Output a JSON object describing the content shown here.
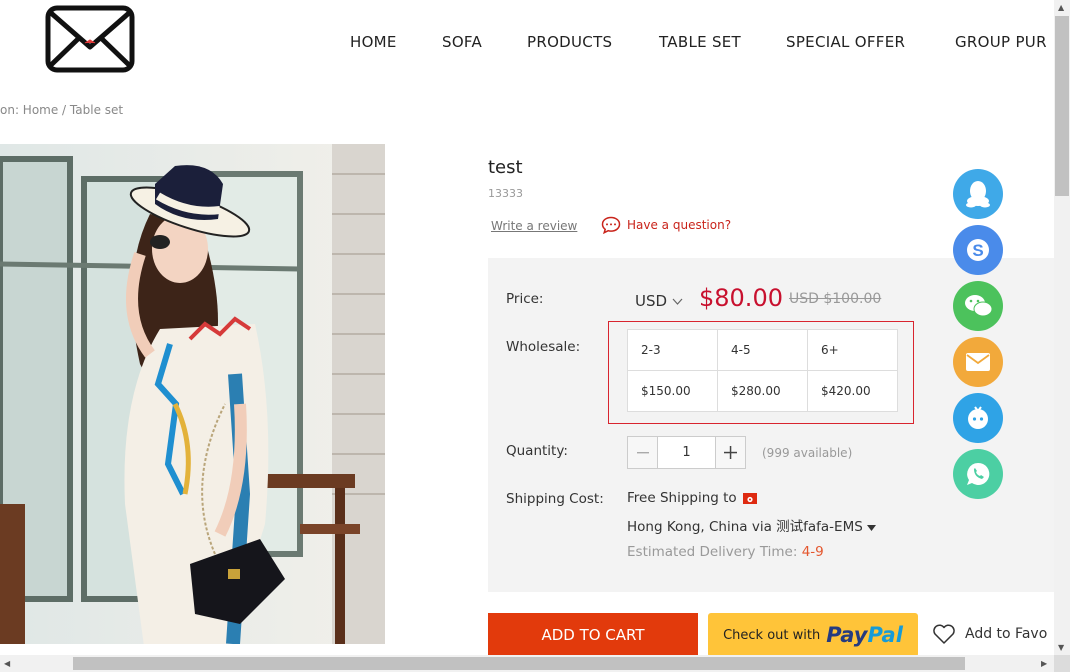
{
  "nav": {
    "items": [
      "HOME",
      "SOFA",
      "PRODUCTS",
      "TABLE SET",
      "SPECIAL OFFER",
      "GROUP PUR"
    ]
  },
  "breadcrumb": "on: Home / Table set",
  "product": {
    "title": "test",
    "sku": "13333",
    "write_review": "Write a review",
    "have_question": "Have a question?"
  },
  "price": {
    "label": "Price:",
    "currency": "USD",
    "current": "$80.00",
    "original": "USD $100.00"
  },
  "wholesale": {
    "label": "Wholesale:",
    "tiers": [
      "2-3",
      "4-5",
      "6+"
    ],
    "prices": [
      "$150.00",
      "$280.00",
      "$420.00"
    ]
  },
  "quantity": {
    "label": "Quantity:",
    "value": "1",
    "available": "(999 available)"
  },
  "shipping": {
    "label": "Shipping Cost:",
    "line1": "Free Shipping to",
    "line2": "Hong Kong, China via 测试fafa-EMS",
    "est_label": "Estimated Delivery Time:",
    "est_value": "4-9"
  },
  "actions": {
    "add_to_cart": "ADD TO CART",
    "paypal_prefix": "Check out with",
    "paypal_brand_a": "Pay",
    "paypal_brand_b": "Pal",
    "favorite": "Add to Favo"
  },
  "colors": {
    "accent_red": "#c8102e",
    "cart_orange": "#e23a0c",
    "paypal_yellow": "#ffc439"
  },
  "float_buttons": [
    "qq-icon",
    "skype-icon",
    "wechat-icon",
    "email-icon",
    "chat-bot-icon",
    "whatsapp-icon"
  ]
}
